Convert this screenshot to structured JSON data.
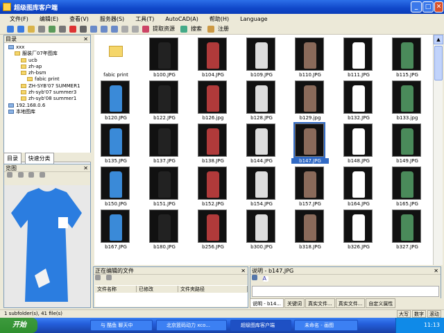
{
  "window": {
    "title": "超级图库客户端",
    "min": "_",
    "max": "□",
    "close": "✕"
  },
  "menu": [
    "文件(F)",
    "编辑(E)",
    "查看(V)",
    "服务器(S)",
    "工具(T)",
    "AutoCAD(A)",
    "帮助(H)",
    "Language"
  ],
  "toolbar": {
    "extract": "提取资源",
    "search": "搜索",
    "register": "注册"
  },
  "tree": {
    "header": "目录",
    "items": [
      {
        "label": "xxx",
        "indent": 0,
        "type": "pc"
      },
      {
        "label": "服装厂07年图库",
        "indent": 1,
        "type": "folder"
      },
      {
        "label": "ucb",
        "indent": 2,
        "type": "folder"
      },
      {
        "label": "zh-ap",
        "indent": 2,
        "type": "folder"
      },
      {
        "label": "zh-bsm",
        "indent": 2,
        "type": "folder"
      },
      {
        "label": "fabic print",
        "indent": 3,
        "type": "folder"
      },
      {
        "label": "ZH-SYB'07 SUMMER1",
        "indent": 2,
        "type": "folder"
      },
      {
        "label": "zh-syb'07 summer3",
        "indent": 2,
        "type": "folder"
      },
      {
        "label": "zh-syb'08 summer1",
        "indent": 2,
        "type": "folder"
      },
      {
        "label": "192.168.0.6",
        "indent": 0,
        "type": "pc"
      },
      {
        "label": "本地图库",
        "indent": 0,
        "type": "pc"
      }
    ]
  },
  "left_tabs": [
    "目录",
    "快速分类"
  ],
  "preview": {
    "header": "览图"
  },
  "thumbs": [
    "fabic print",
    "b100.JPG",
    "b104.JPG",
    "b109.JPG",
    "b110.JPG",
    "b111.JPG",
    "b115.JPG",
    "b120.JPG",
    "b122.JPG",
    "b126.jpg",
    "b128.JPG",
    "b129.jpg",
    "b132.JPG",
    "b133.jpg",
    "b135.JPG",
    "b137.JPG",
    "b138.JPG",
    "b144.JPG",
    "b147.JPG",
    "b148.JPG",
    "b149.JPG",
    "b150.JPG",
    "b151.JPG",
    "b152.JPG",
    "b154.JPG",
    "b157.JPG",
    "b164.JPG",
    "b165.JPG",
    "b167.JPG",
    "b180.JPG",
    "b256.JPG",
    "b300.JPG",
    "b318.JPG",
    "b326.JPG",
    "b327.JPG"
  ],
  "edit": {
    "header": "正在编辑的文件",
    "cols": [
      "文件名称",
      "已修改",
      "文件夹路径"
    ]
  },
  "desc": {
    "header": "说明 - b147.JPG"
  },
  "desc_tabs": [
    "说明 - b14...",
    "关键词",
    "真实文件...",
    "真实文件...",
    "自定义属性"
  ],
  "status": {
    "left": "1 subfolder(s), 41 file(s)",
    "r1": "大写",
    "r2": "数字",
    "r3": "滚动"
  },
  "taskbar": {
    "start": "开始",
    "tasks": [
      "与 酷鱼 聊天中",
      "北京篮码动力 xco...",
      "超级图库客户端",
      "未命名 - 画图"
    ],
    "clock": "11:13"
  }
}
